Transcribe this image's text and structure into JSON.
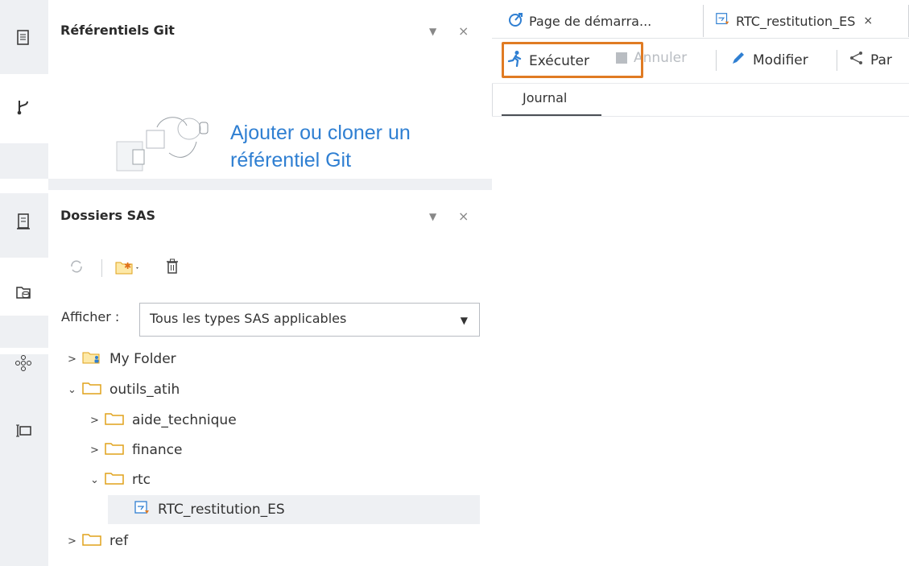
{
  "git_panel": {
    "title": "Référentiels Git",
    "empty_line1": "Ajouter ou cloner un",
    "empty_line2": "référentiel Git"
  },
  "sas_panel": {
    "title": "Dossiers SAS",
    "filter_label": "Afficher :",
    "filter_value": "Tous les types SAS applicables",
    "tree": [
      {
        "label": "My Folder",
        "expanded": false
      },
      {
        "label": "outils_atih",
        "expanded": true
      },
      {
        "label": "aide_technique",
        "expanded": false
      },
      {
        "label": "finance",
        "expanded": false
      },
      {
        "label": "rtc",
        "expanded": true
      },
      {
        "label": "RTC_restitution_ES",
        "selected": true
      },
      {
        "label": "ref",
        "expanded": false
      }
    ]
  },
  "editor": {
    "tabs": [
      {
        "label": "Page de démarra..."
      },
      {
        "label": "RTC_restitution_ES"
      }
    ],
    "toolbar": {
      "run": "Exécuter",
      "cancel": "Annuler",
      "edit": "Modifier",
      "share": "Par"
    },
    "subtab": "Journal"
  },
  "colors": {
    "accent_blue": "#2f7fd2",
    "highlight_orange": "#e07b23",
    "folder_yellow": "#f2c12e",
    "rail_bg": "#eef0f3"
  }
}
